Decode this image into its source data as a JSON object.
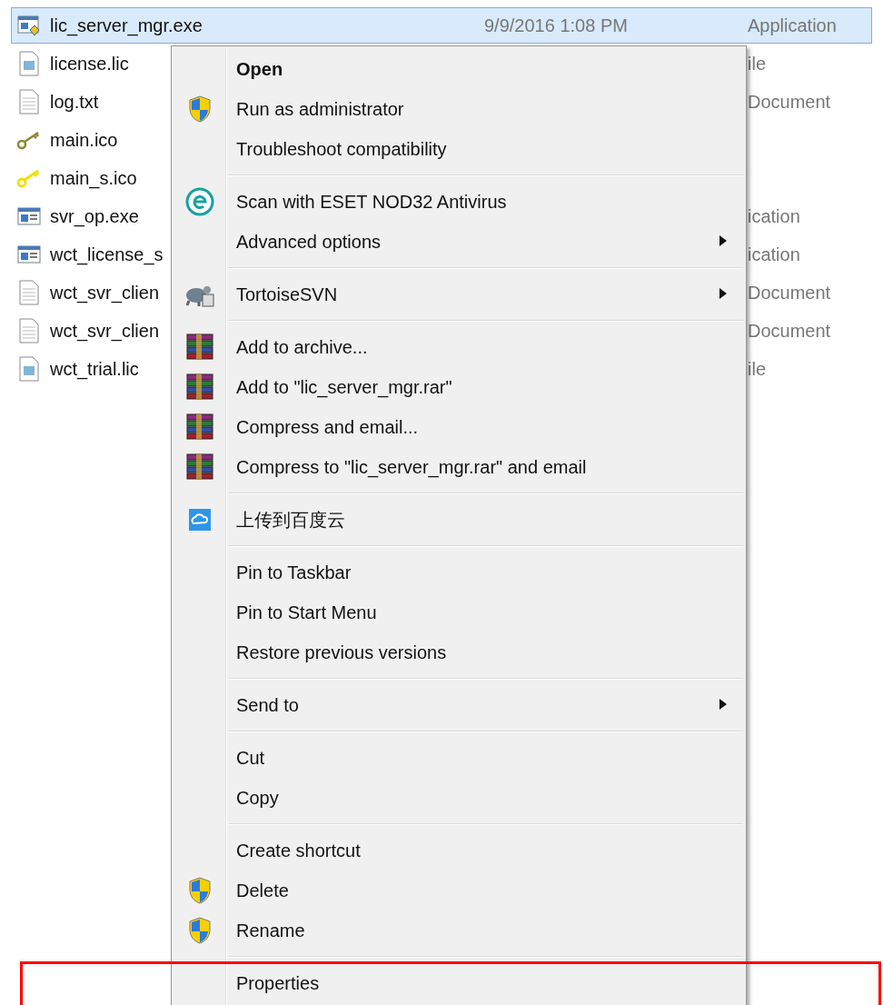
{
  "files": [
    {
      "name": "lic_server_mgr.exe",
      "date": "9/9/2016 1:08 PM",
      "type": "Application",
      "kind": "exe",
      "selected": true
    },
    {
      "name": "license.lic",
      "type": "ile",
      "kind": "lic",
      "selected": false
    },
    {
      "name": "log.txt",
      "type": "Document",
      "kind": "text",
      "selected": false
    },
    {
      "name": "main.ico",
      "kind": "key-dim",
      "selected": false
    },
    {
      "name": "main_s.ico",
      "kind": "key",
      "selected": false
    },
    {
      "name": "svr_op.exe",
      "type": "ication",
      "kind": "app",
      "selected": false
    },
    {
      "name": "wct_license_s",
      "type": "ication",
      "kind": "app",
      "selected": false
    },
    {
      "name": "wct_svr_clien",
      "type": "Document",
      "kind": "text",
      "selected": false
    },
    {
      "name": "wct_svr_clien",
      "type": "Document",
      "kind": "text",
      "selected": false
    },
    {
      "name": "wct_trial.lic",
      "type": "ile",
      "kind": "lic",
      "selected": false
    }
  ],
  "menu": {
    "groups": [
      {
        "items": [
          {
            "label": "Open",
            "bold": true
          },
          {
            "label": "Run as administrator",
            "kind": "shield"
          },
          {
            "label": "Troubleshoot compatibility"
          }
        ]
      },
      {
        "items": [
          {
            "label": "Scan with ESET NOD32 Antivirus",
            "kind": "eset"
          },
          {
            "label": "Advanced options",
            "submenu": true
          }
        ]
      },
      {
        "items": [
          {
            "label": "TortoiseSVN",
            "kind": "turtle",
            "submenu": true
          }
        ]
      },
      {
        "items": [
          {
            "label": "Add to archive...",
            "kind": "books"
          },
          {
            "label": "Add to \"lic_server_mgr.rar\"",
            "kind": "books"
          },
          {
            "label": "Compress and email...",
            "kind": "books"
          },
          {
            "label": "Compress to \"lic_server_mgr.rar\" and email",
            "kind": "books"
          }
        ]
      },
      {
        "items": [
          {
            "label": "上传到百度云",
            "kind": "cloud"
          }
        ]
      },
      {
        "items": [
          {
            "label": "Pin to Taskbar"
          },
          {
            "label": "Pin to Start Menu"
          },
          {
            "label": "Restore previous versions"
          }
        ]
      },
      {
        "items": [
          {
            "label": "Send to",
            "submenu": true
          }
        ]
      },
      {
        "items": [
          {
            "label": "Cut"
          },
          {
            "label": "Copy"
          }
        ]
      },
      {
        "items": [
          {
            "label": "Create shortcut"
          },
          {
            "label": "Delete",
            "kind": "shield"
          },
          {
            "label": "Rename",
            "kind": "shield"
          }
        ]
      },
      {
        "items": [
          {
            "label": "Properties",
            "highlighted": true
          }
        ]
      }
    ]
  }
}
